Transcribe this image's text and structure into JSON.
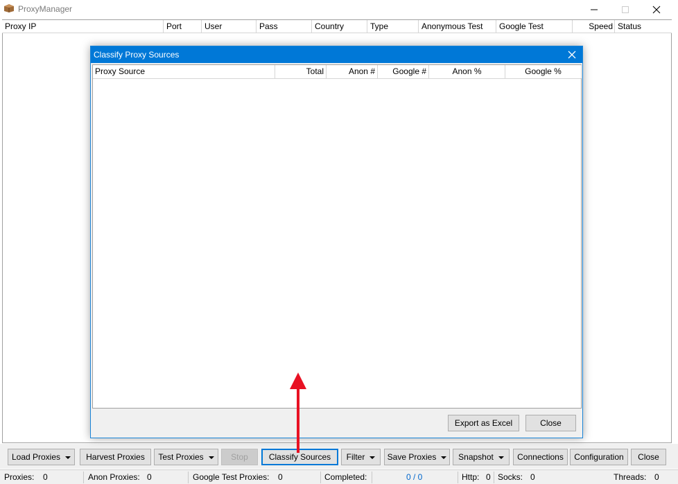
{
  "window": {
    "title": "ProxyManager"
  },
  "grid": {
    "columns": [
      "Proxy IP",
      "Port",
      "User",
      "Pass",
      "Country",
      "Type",
      "Anonymous Test",
      "Google Test",
      "Speed",
      "Status"
    ]
  },
  "dialog": {
    "title": "Classify Proxy Sources",
    "columns": [
      "Proxy Source",
      "Total",
      "Anon #",
      "Google #",
      "Anon %",
      "Google %"
    ],
    "export_label": "Export as Excel",
    "close_label": "Close"
  },
  "toolbar": {
    "load": "Load Proxies",
    "harvest": "Harvest Proxies",
    "test": "Test Proxies",
    "stop": "Stop",
    "classify": "Classify Sources",
    "filter": "Filter",
    "save": "Save Proxies",
    "snapshot": "Snapshot",
    "connections": "Connections",
    "configuration": "Configuration",
    "close": "Close"
  },
  "status": {
    "proxies_label": "Proxies:",
    "proxies_value": "0",
    "anon_label": "Anon Proxies:",
    "anon_value": "0",
    "google_label": "Google Test Proxies:",
    "google_value": "0",
    "completed_label": "Completed:",
    "completed_value": "0 / 0",
    "http_label": "Http:",
    "http_value": "0",
    "socks_label": "Socks:",
    "socks_value": "0",
    "threads_label": "Threads:",
    "threads_value": "0"
  },
  "colors": {
    "accent": "#0078d7",
    "arrow": "#e81123",
    "status_value": "#0066cc"
  }
}
